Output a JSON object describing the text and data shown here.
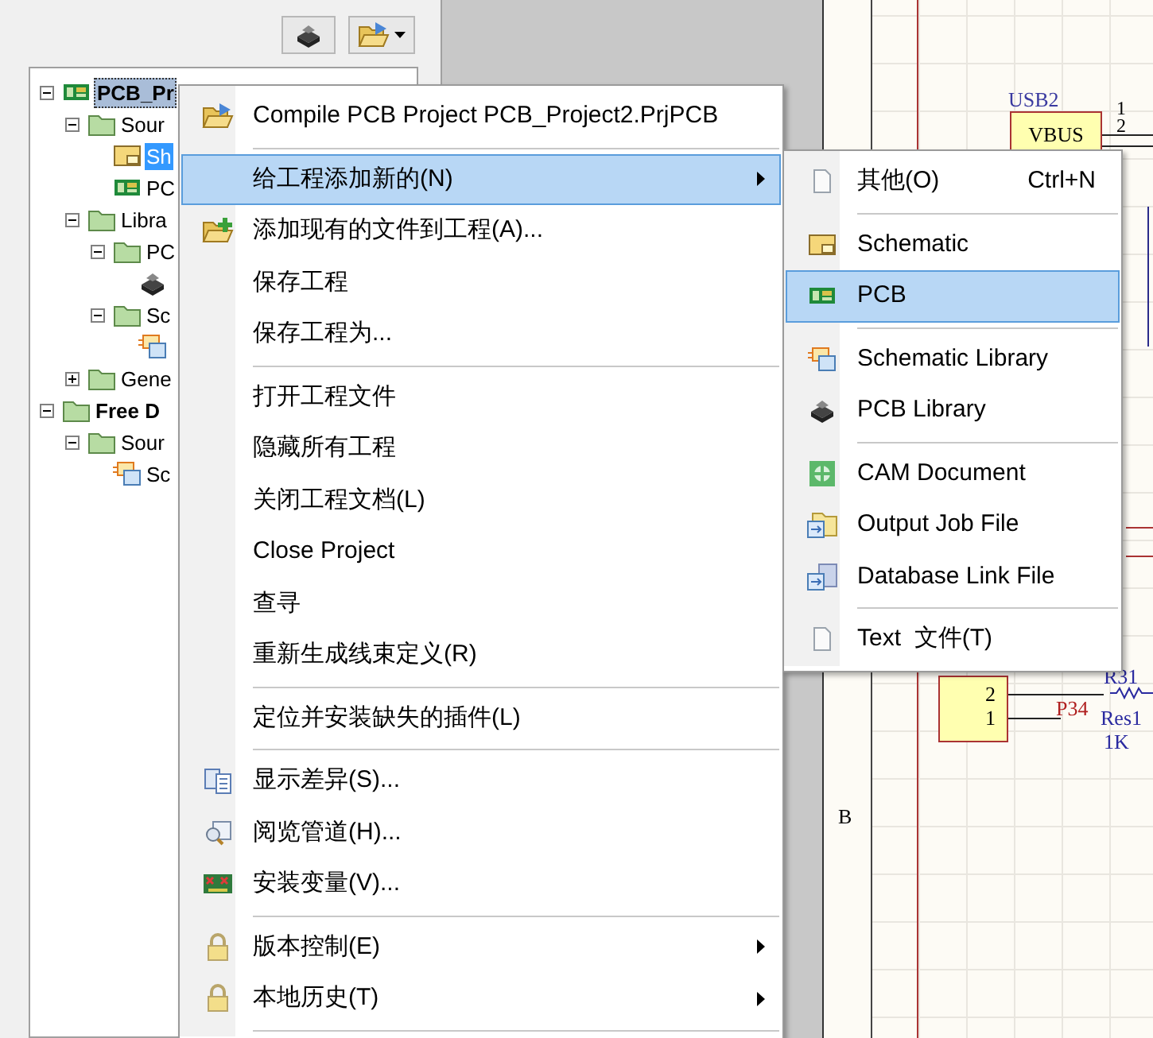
{
  "tree": [
    {
      "label": "PCB_Pr",
      "kind": "pcb-project",
      "expanded": true,
      "selected": false,
      "focused": true,
      "children": [
        {
          "label": "Sour",
          "kind": "folder",
          "expanded": true,
          "selected": false,
          "focused": false,
          "children": [
            {
              "label": "Sh",
              "kind": "schematic",
              "selected": true,
              "focused": false
            },
            {
              "label": "PC",
              "kind": "pcb",
              "selected": false,
              "focused": false
            }
          ]
        },
        {
          "label": "Libra",
          "kind": "folder",
          "expanded": true,
          "selected": false,
          "focused": false,
          "children": [
            {
              "label": "PC",
              "kind": "folder",
              "expanded": true,
              "selected": false,
              "focused": false,
              "children": [
                {
                  "kind": "pcblib"
                }
              ]
            },
            {
              "label": "Sc",
              "kind": "folder",
              "expanded": true,
              "selected": false,
              "focused": false,
              "children": [
                {
                  "kind": "schlib"
                }
              ]
            }
          ]
        },
        {
          "label": "Gene",
          "kind": "folder",
          "expanded": false,
          "selected": false,
          "focused": false
        }
      ]
    },
    {
      "label": "Free D",
      "kind": "free-documents",
      "expanded": true,
      "selected": false,
      "focused": false,
      "children": [
        {
          "label": "Sour",
          "kind": "folder",
          "expanded": true,
          "selected": false,
          "focused": false,
          "children": [
            {
              "label": "Sc",
              "kind": "schlib",
              "selected": false,
              "focused": false
            }
          ]
        }
      ]
    }
  ],
  "context_menu": {
    "items": [
      {
        "kind": "command",
        "label": "Compile PCB Project PCB_Project2.PrjPCB",
        "submenu": false,
        "selected": false
      },
      {
        "kind": "separator"
      },
      {
        "kind": "command",
        "label": "给工程添加新的(N)",
        "submenu": true,
        "selected": true
      },
      {
        "kind": "command",
        "label": "添加现有的文件到工程(A)...",
        "submenu": false,
        "selected": false
      },
      {
        "kind": "command",
        "label": "保存工程",
        "submenu": false,
        "selected": false
      },
      {
        "kind": "command",
        "label": "保存工程为...",
        "submenu": false,
        "selected": false
      },
      {
        "kind": "separator"
      },
      {
        "kind": "command",
        "label": "打开工程文件",
        "submenu": false,
        "selected": false
      },
      {
        "kind": "command",
        "label": "隐藏所有工程",
        "submenu": false,
        "selected": false
      },
      {
        "kind": "command",
        "label": "关闭工程文档(L)",
        "submenu": false,
        "selected": false
      },
      {
        "kind": "command",
        "label": "Close Project",
        "submenu": false,
        "selected": false
      },
      {
        "kind": "command",
        "label": "查寻",
        "submenu": false,
        "selected": false
      },
      {
        "kind": "command",
        "label": "重新生成线束定义(R)",
        "submenu": false,
        "selected": false
      },
      {
        "kind": "separator"
      },
      {
        "kind": "command",
        "label": "定位并安装缺失的插件(L)",
        "submenu": false,
        "selected": false
      },
      {
        "kind": "separator"
      },
      {
        "kind": "command",
        "label": "显示差异(S)...",
        "submenu": false,
        "selected": false
      },
      {
        "kind": "command",
        "label": "阅览管道(H)...",
        "submenu": false,
        "selected": false
      },
      {
        "kind": "command",
        "label": "安装变量(V)...",
        "submenu": false,
        "selected": false
      },
      {
        "kind": "separator"
      },
      {
        "kind": "command",
        "label": "版本控制(E)",
        "submenu": true,
        "selected": false
      },
      {
        "kind": "command",
        "label": "本地历史(T)",
        "submenu": true,
        "selected": false
      },
      {
        "kind": "separator"
      }
    ]
  },
  "submenu": {
    "items": [
      {
        "kind": "command",
        "label": "其他(O)",
        "shortcut": "Ctrl+N",
        "selected": false
      },
      {
        "kind": "separator"
      },
      {
        "kind": "command",
        "label": "Schematic",
        "selected": false
      },
      {
        "kind": "command",
        "label": "PCB",
        "selected": true
      },
      {
        "kind": "separator"
      },
      {
        "kind": "command",
        "label": "Schematic Library",
        "selected": false
      },
      {
        "kind": "command",
        "label": "PCB Library",
        "selected": false
      },
      {
        "kind": "separator"
      },
      {
        "kind": "command",
        "label": "CAM Document",
        "selected": false
      },
      {
        "kind": "command",
        "label": "Output Job File",
        "selected": false
      },
      {
        "kind": "command",
        "label": "Database Link File",
        "selected": false
      },
      {
        "kind": "separator"
      },
      {
        "kind": "command",
        "label": "Text  文件(T)",
        "selected": false
      }
    ]
  },
  "schematic": {
    "zone": "B",
    "connector": {
      "designator": "USB2",
      "pin_name": "VBUS",
      "pins": [
        "1",
        "2"
      ]
    },
    "buzzer": {
      "pins": [
        "2",
        "1"
      ]
    },
    "net_label": "P34",
    "resistor": {
      "designator": "R31",
      "comment": "Res1",
      "value": "1K"
    }
  }
}
